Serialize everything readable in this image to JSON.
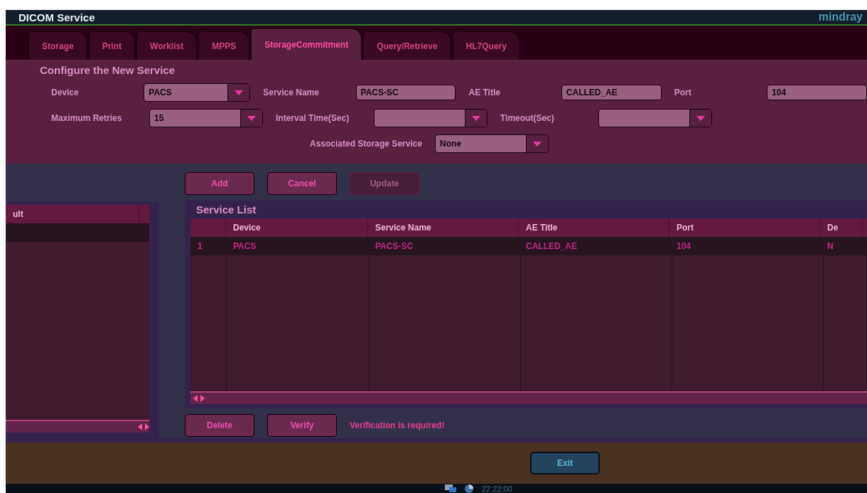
{
  "window": {
    "title": "DICOM Service",
    "logo": "mindray"
  },
  "tabs": [
    {
      "label": "Storage",
      "selected": false
    },
    {
      "label": "Print",
      "selected": false
    },
    {
      "label": "Worklist",
      "selected": false
    },
    {
      "label": "MPPS",
      "selected": false
    },
    {
      "label": "StorageCommitment",
      "selected": true
    },
    {
      "label": "Query/Retrieve",
      "selected": false
    },
    {
      "label": "HL7Query",
      "selected": false
    }
  ],
  "form": {
    "title": "Configure the New Service",
    "rows": [
      {
        "fields": [
          {
            "label": "Device",
            "value": "PACS",
            "kind": "dropdown"
          },
          {
            "label": "Service Name",
            "value": "PACS-SC",
            "kind": "text"
          },
          {
            "label": "AE Title",
            "value": "CALLED_AE",
            "kind": "text"
          },
          {
            "label": "Port",
            "value": "104",
            "kind": "text"
          }
        ]
      },
      {
        "fields": [
          {
            "label": "Maximum Retries",
            "value": "15",
            "kind": "dropdown"
          },
          {
            "label": "Interval Time(Sec)",
            "kind": "dropdown"
          },
          {
            "label": "Timeout(Sec)",
            "kind": "dropdown"
          }
        ]
      },
      {
        "fields": [
          {
            "label": "Associated Storage Service",
            "value": "None",
            "kind": "dropdown"
          }
        ]
      }
    ]
  },
  "actions": [
    {
      "label": "Add",
      "disabled": false
    },
    {
      "label": "Cancel",
      "disabled": false
    },
    {
      "label": "Update",
      "disabled": true
    }
  ],
  "left_table": {
    "columns": [
      {
        "label": "ult"
      }
    ]
  },
  "service_list": {
    "title": "Service List",
    "columns": [
      {
        "label": "Device"
      },
      {
        "label": "Service Name"
      },
      {
        "label": "AE Title"
      },
      {
        "label": "Port"
      },
      {
        "label": "De"
      }
    ],
    "rows": [
      {
        "index": "1",
        "cells": [
          "PACS",
          "PACS-SC",
          "CALLED_AE",
          "104",
          "N"
        ],
        "selected": true
      }
    ]
  },
  "list_actions": [
    {
      "label": "Delete",
      "disabled": false
    },
    {
      "label": "Verify",
      "disabled": false
    }
  ],
  "status": "Verification is required!",
  "exit": "Exit",
  "clock": "22:22:00"
}
